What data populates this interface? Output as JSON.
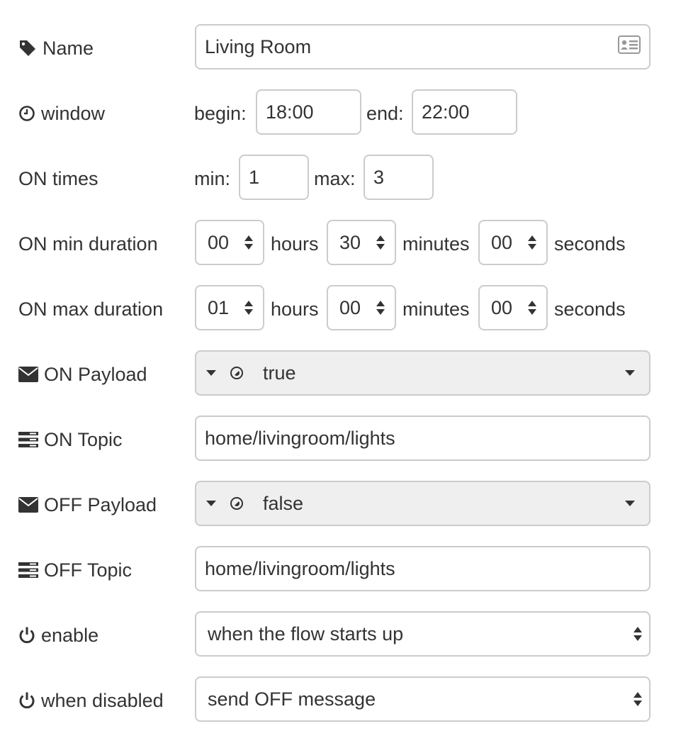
{
  "name": {
    "label": "Name",
    "value": "Living Room"
  },
  "window": {
    "label": "window",
    "begin_label": "begin:",
    "begin_value": "18:00",
    "end_label": "end:",
    "end_value": "22:00"
  },
  "on_times": {
    "label": "ON times",
    "min_label": "min:",
    "min_value": "1",
    "max_label": "max:",
    "max_value": "3"
  },
  "on_min_duration": {
    "label": "ON min duration",
    "hours": "00",
    "minutes": "30",
    "seconds": "00"
  },
  "on_max_duration": {
    "label": "ON max duration",
    "hours": "01",
    "minutes": "00",
    "seconds": "00"
  },
  "units": {
    "hours": "hours",
    "minutes": "minutes",
    "seconds": "seconds"
  },
  "on_payload": {
    "label": "ON Payload",
    "value": "true",
    "type_icon": "boolean-icon"
  },
  "on_topic": {
    "label": "ON Topic",
    "value": "home/livingroom/lights"
  },
  "off_payload": {
    "label": "OFF Payload",
    "value": "false",
    "type_icon": "boolean-icon"
  },
  "off_topic": {
    "label": "OFF Topic",
    "value": "home/livingroom/lights"
  },
  "enable": {
    "label": "enable",
    "selected": "when the flow starts up"
  },
  "when_disabled": {
    "label": "when disabled",
    "selected": "send OFF message"
  },
  "colors": {
    "border": "#cccccc",
    "text": "#333333",
    "typed_bg": "#efefef"
  }
}
